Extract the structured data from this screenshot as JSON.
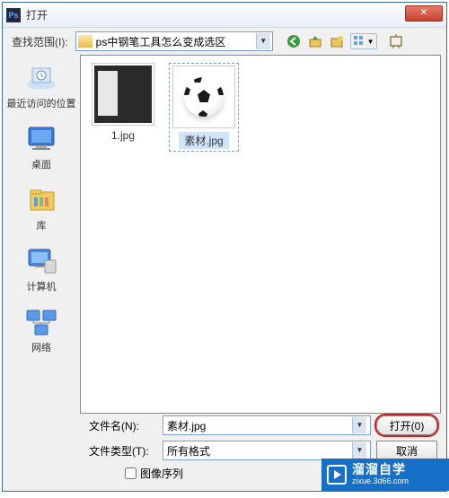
{
  "titlebar": {
    "title": "打开",
    "close": "✕"
  },
  "toolbar": {
    "look_in_label": "查找范围(I):",
    "location": "ps中钢笔工具怎么变成选区",
    "icons": {
      "back": "back-icon",
      "up": "up-icon",
      "new": "new-folder-icon",
      "views": "views-icon",
      "pin": "pin-icon"
    }
  },
  "places": [
    {
      "label": "最近访问的位置",
      "icon": "recent"
    },
    {
      "label": "桌面",
      "icon": "desktop"
    },
    {
      "label": "库",
      "icon": "library"
    },
    {
      "label": "计算机",
      "icon": "computer"
    },
    {
      "label": "网络",
      "icon": "network"
    }
  ],
  "files": [
    {
      "name": "1.jpg",
      "kind": "psd-thumb",
      "selected": false
    },
    {
      "name": "素材.jpg",
      "kind": "ball",
      "selected": true
    }
  ],
  "form": {
    "filename_label": "文件名(N):",
    "filename_value": "素材.jpg",
    "filetype_label": "文件类型(T):",
    "filetype_value": "所有格式",
    "open_button": "打开(0)",
    "cancel_button": "取消",
    "sequence_checkbox": "图像序列"
  },
  "watermark": {
    "main": "溜溜自学",
    "sub": "zixue.3d66.com"
  }
}
